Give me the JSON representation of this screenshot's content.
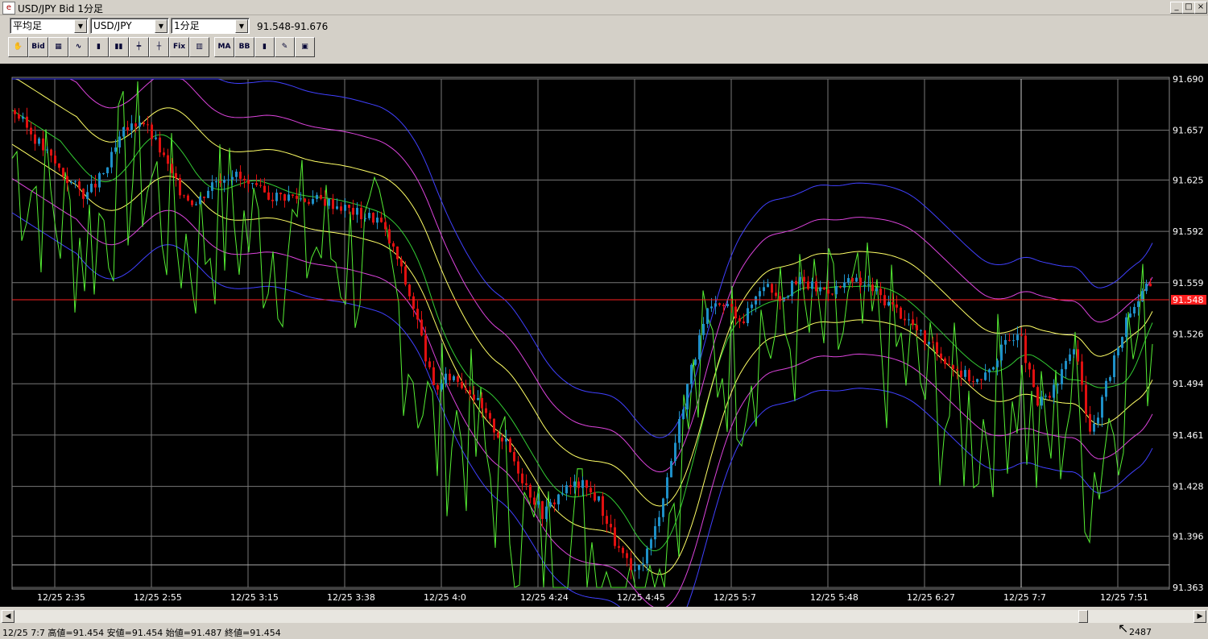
{
  "window": {
    "title": "USD/JPY Bid 1分足",
    "buttons": [
      "_",
      "□",
      "×"
    ]
  },
  "toolbar": {
    "chart_type": "平均足",
    "symbol": "USD/JPY",
    "timeframe": "1分足",
    "price_range": "91.548-91.676",
    "tools": [
      {
        "name": "hand-tool",
        "label": "✋"
      },
      {
        "name": "bid-ask-tool",
        "label": "Bid"
      },
      {
        "name": "chart-icon",
        "label": "▦"
      },
      {
        "name": "oscillator-icon",
        "label": "∿"
      },
      {
        "name": "candle-icon",
        "label": "▮"
      },
      {
        "name": "candle2-icon",
        "label": "▮▮"
      },
      {
        "name": "candle3-icon",
        "label": "┿"
      },
      {
        "name": "candle4-icon",
        "label": "┼"
      },
      {
        "name": "fix-icon",
        "label": "Fix"
      },
      {
        "name": "volume-icon",
        "label": "▥"
      },
      {
        "name": "ma-fix-icon",
        "label": "MA"
      },
      {
        "name": "bb-fix-icon",
        "label": "BB"
      },
      {
        "name": "candle-color-icon",
        "label": "▮"
      },
      {
        "name": "pen-icon",
        "label": "✎"
      },
      {
        "name": "camera-icon",
        "label": "▣"
      }
    ]
  },
  "chart_data": {
    "type": "candlestick",
    "symbol": "USD/JPY",
    "y_ticks": [
      "91.690",
      "91.657",
      "91.625",
      "91.592",
      "91.559",
      "91.526",
      "91.494",
      "91.461",
      "91.428",
      "91.396",
      "91.363"
    ],
    "ylim": [
      91.363,
      91.69
    ],
    "current_price_label": "91.548",
    "current_price": 91.548,
    "x_ticks": [
      "12/25 2:35",
      "12/25 2:55",
      "12/25 3:15",
      "12/25 3:38",
      "12/25 4:0",
      "12/25 4:24",
      "12/25 4:45",
      "12/25 5:7",
      "12/25 5:48",
      "12/25 6:27",
      "12/25 7:7",
      "12/25 7:51"
    ],
    "colors": {
      "up": "#1e90c8",
      "down": "#e01010",
      "ma_fast": "#33cc33",
      "ma_slow": "#33cc33",
      "bb1": "#ffff66",
      "bb2": "#dd44dd",
      "bb3": "#4040ff",
      "oscillator": "#55ee33",
      "current_line": "#ff2020",
      "grid": "#777777"
    },
    "price_path": [
      91.67,
      91.655,
      91.64,
      91.625,
      91.615,
      91.63,
      91.655,
      91.665,
      91.645,
      91.62,
      91.61,
      91.625,
      91.63,
      91.62,
      91.615,
      91.615,
      91.613,
      91.612,
      91.608,
      91.603,
      91.6,
      91.575,
      91.54,
      91.49,
      91.5,
      91.49,
      91.47,
      91.455,
      91.43,
      91.41,
      91.425,
      91.43,
      91.42,
      91.39,
      91.37,
      91.395,
      91.445,
      91.5,
      91.54,
      91.545,
      91.535,
      91.56,
      91.55,
      91.56,
      91.555,
      91.555,
      91.56,
      91.555,
      91.545,
      91.535,
      91.52,
      91.51,
      91.5,
      91.495,
      91.515,
      91.53,
      91.48,
      91.49,
      91.52,
      91.46,
      91.5,
      91.54,
      91.555
    ]
  },
  "scrollbar": {
    "left": "◀",
    "right": "▶"
  },
  "status": {
    "text": "12/25 7:7  高値=91.454 安値=91.454 始値=91.487 終値=91.454",
    "count": "2487"
  }
}
